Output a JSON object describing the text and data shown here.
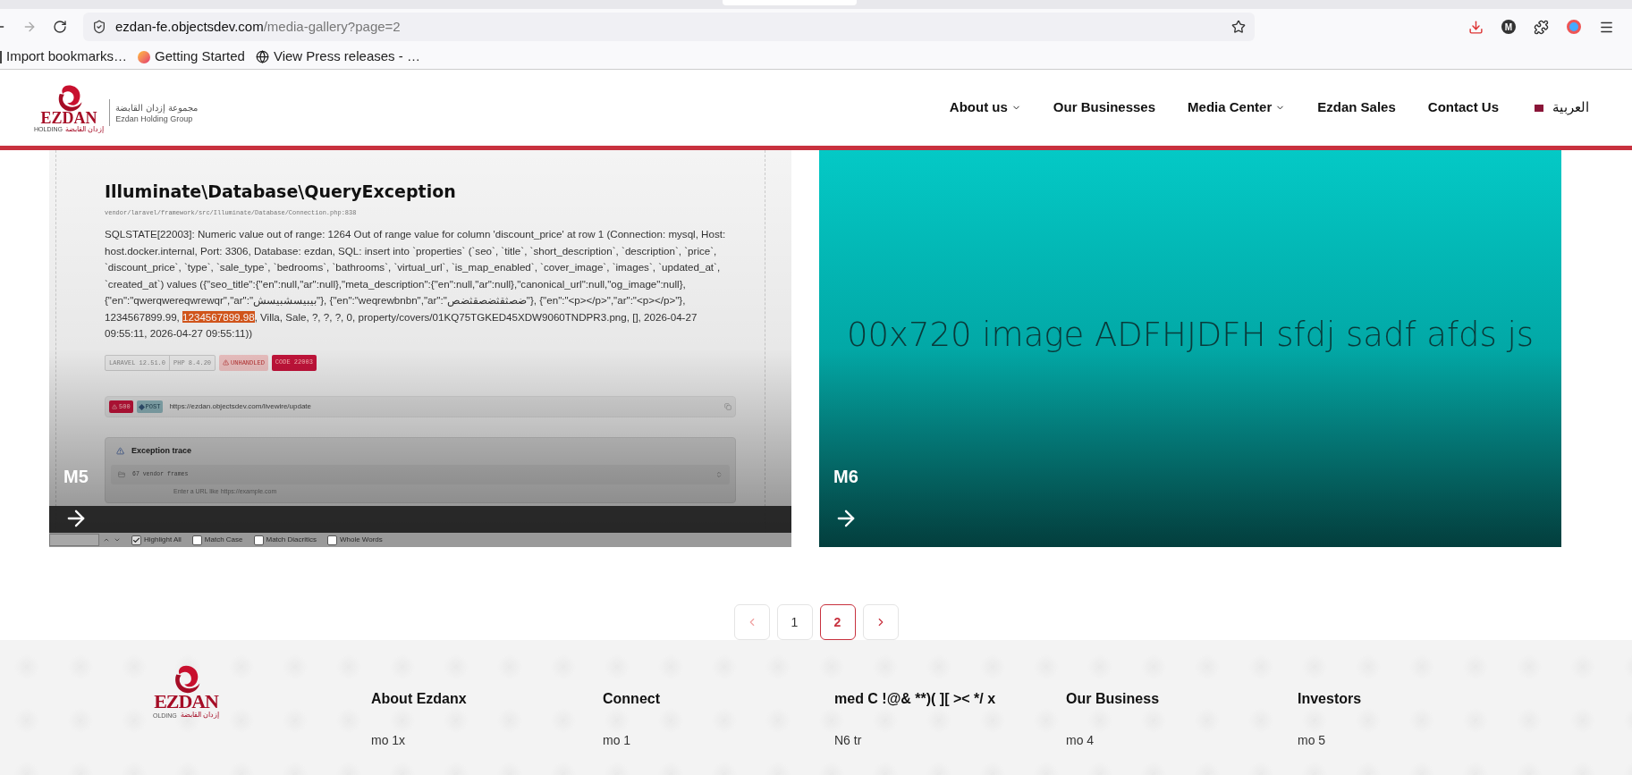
{
  "browser": {
    "url_host": "ezdan-fe.objectsdev.com",
    "url_path": "/media-gallery?page=2",
    "profile_initial": "M",
    "bookmarks": [
      {
        "kind": "import",
        "label": "Import bookmarks…"
      },
      {
        "kind": "firefox",
        "label": "Getting Started"
      },
      {
        "kind": "globe",
        "label": "View Press releases - …"
      }
    ]
  },
  "header": {
    "logo": {
      "name": "EZDAN",
      "sub_en": "HOLDING",
      "sub_ar": "إزدان القابضة"
    },
    "tagline_ar": "مجموعة إزدان القابضة",
    "tagline_en": "Ezdan Holding Group",
    "nav": [
      {
        "label": "About us",
        "dropdown": true
      },
      {
        "label": "Our Businesses",
        "dropdown": false
      },
      {
        "label": "Media Center",
        "dropdown": true
      },
      {
        "label": "Ezdan Sales",
        "dropdown": false
      },
      {
        "label": "Contact Us",
        "dropdown": false
      }
    ],
    "language": "العربية"
  },
  "gallery": [
    {
      "kind": "screenshot",
      "title": "M5",
      "shot": {
        "exception": "Illuminate\\Database\\QueryException",
        "file": "vendor/laravel/framework/src/Illuminate/Database/Connection.php:838",
        "message_before": "SQLSTATE[22003]: Numeric value out of range: 1264 Out of range value for column 'discount_price' at row 1 (Connection: mysql, Host: host.docker.internal, Port: 3306, Database: ezdan, SQL: insert into `properties` (`seo`, `title`, `short_description`, `description`, `price`, `discount_price`, `type`, `sale_type`, `bedrooms`, `bathrooms`, `virtual_url`, `is_map_enabled`, `cover_image`, `images`, `updated_at`, `created_at`) values ({\"seo_title\":{\"en\":null,\"ar\":null},\"meta_description\":{\"en\":null,\"ar\":null},\"canonical_url\":null,\"og_image\":null}, {\"en\":\"qwerqwereqwrewqr\",\"ar\":\"بيبيسشبيسش\"}, {\"en\":\"weqrewbnbn\",\"ar\":\"ضصثقثضصقثضص\"}, {\"en\":\"<p></p>\",\"ar\":\"<p></p>\"}, 1234567899.99, ",
        "message_highlight": "1234567899.98",
        "message_after": ", Villa, Sale, ?, ?, ?, 0, property/covers/01KQ75TGKED45XDW9060TNDPR3.png, [], 2026-04-27 09:55:11, 2026-04-27 09:55:11))",
        "framework": "LARAVEL",
        "framework_version": "12.51.0",
        "php": "PHP",
        "php_version": "8.4.20",
        "unhandled": "UNHANDLED",
        "code": "CODE 22003",
        "status": "500",
        "method": "POST",
        "request_url": "https://ezdan.objectsdev.com/livewire/update",
        "trace_title": "Exception trace",
        "vendor_frames": "67 vendor frames",
        "url_hint": "Enter a URL like https://example.com",
        "find_options": [
          {
            "label": "Highlight All",
            "checked": true
          },
          {
            "label": "Match Case",
            "checked": false
          },
          {
            "label": "Match Diacritics",
            "checked": false
          },
          {
            "label": "Whole Words",
            "checked": false
          }
        ]
      }
    },
    {
      "kind": "image",
      "title": "M6",
      "image_text": "00x720 image ADFHJDFH sfdj sadf afds js"
    }
  ],
  "pagination": {
    "prev_disabled": true,
    "next_disabled": false,
    "pages": [
      {
        "label": "1",
        "selected": false
      },
      {
        "label": "2",
        "selected": true
      }
    ]
  },
  "footer": {
    "logo": {
      "name": "EZDAN",
      "sub_en": "OLDING",
      "sub_ar": "إزدان القابضة"
    },
    "columns": [
      {
        "heading": "About Ezdanx",
        "items": [
          "mo 1x"
        ]
      },
      {
        "heading": "Connect",
        "items": [
          "mo 1"
        ]
      },
      {
        "heading": "med C !@& **)( ][ >< */ x",
        "items": [
          "N6 tr"
        ]
      },
      {
        "heading": "Our Business",
        "items": [
          "mo 4"
        ]
      },
      {
        "heading": "Investors",
        "items": [
          "mo 5"
        ]
      }
    ]
  }
}
